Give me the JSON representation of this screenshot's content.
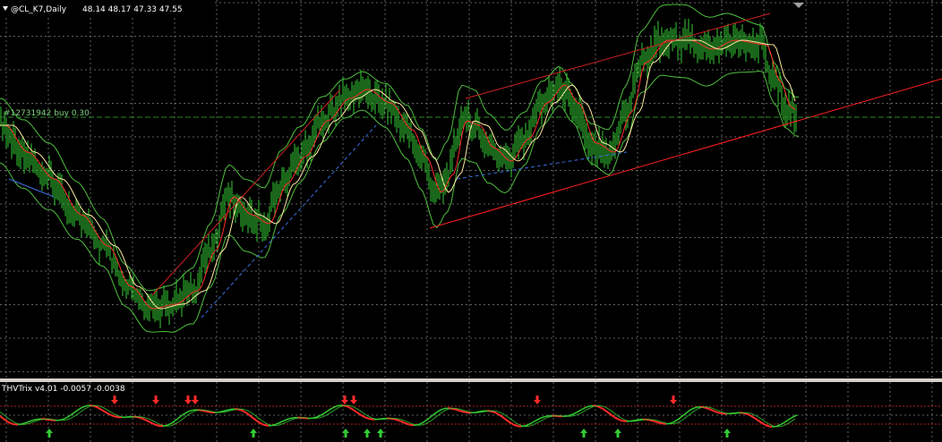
{
  "chart": {
    "symbol_label": "@CL_K7,Daily",
    "ohlc_label": "48.14 48.17 47.33 47.55",
    "order_label": "#12731942 buy 0.30",
    "indicator_label": "THVTrix v4.01 -0.0057 -0.0038",
    "timeframe": "Daily"
  },
  "colors": {
    "background": "#000000",
    "grid": "#8a8a8a",
    "candles": "#33cc33",
    "bands": "#4fbf3f",
    "ma_fast": "#ff2a2a",
    "ma_slow": "#ffe9a0",
    "trendline": "#ff2020",
    "channel": "#cc2020",
    "dashed_support": "#3a6fe0",
    "order_line": "#2e8b2e",
    "indicator_up": "#33cc33",
    "indicator_down": "#ff2a2a",
    "indicator_level": "#b02020"
  },
  "signals": {
    "down_arrow_icon": "down-arrow-icon",
    "up_arrow_icon": "up-arrow-icon"
  }
}
